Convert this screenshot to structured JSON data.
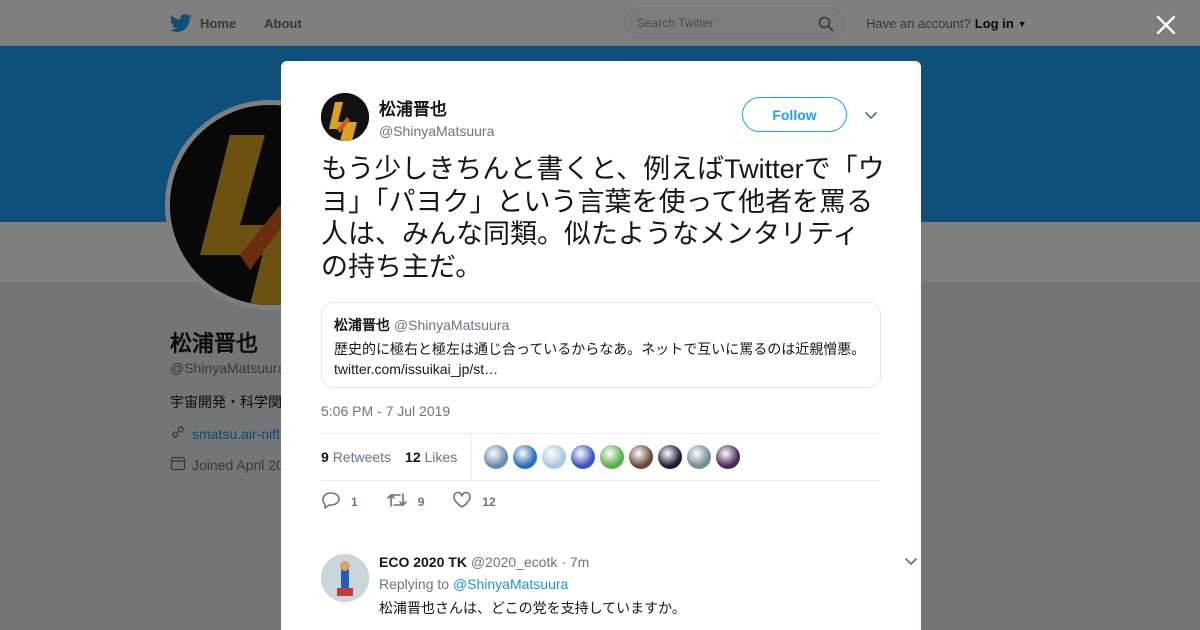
{
  "topbar": {
    "nav": [
      {
        "label": "Home",
        "icon": "bird-icon"
      },
      {
        "label": "About"
      }
    ],
    "search_placeholder": "Search Twitter",
    "account_prompt": "Have an account?",
    "login_label": "Log in"
  },
  "profile": {
    "name": "松浦晋也",
    "handle": "@ShinyaMatsuura",
    "bio": "宇宙開発・科学関",
    "website": "smatsu.air-nift",
    "joined": "Joined April 20"
  },
  "tweet": {
    "author_name": "松浦晋也",
    "author_handle": "@ShinyaMatsuura",
    "follow_label": "Follow",
    "text": "もう少しきちんと書くと、例えばTwitterで「ウヨ」「パヨク」という言葉を使って他者を罵る人は、みんな同類。似たようなメンタリティの持ち主だ。",
    "quote": {
      "name": "松浦晋也",
      "handle": "@ShinyaMatsuura",
      "text_line1": "歴史的に極右と極左は通じ合っているからなあ。ネットで互いに罵るのは近親憎悪。",
      "text_line2": "twitter.com/issuikai_jp/st…"
    },
    "timestamp": "5:06 PM - 7 Jul 2019",
    "retweets_count": "9",
    "retweets_label": "Retweets",
    "likes_count": "12",
    "likes_label": "Likes",
    "liker_colors": [
      "#6a8caf",
      "#2a6fb8",
      "#a9c8e0",
      "#3d54c2",
      "#58b04a",
      "#6b4a3a",
      "#1c1c3a",
      "#6f8f9a",
      "#4b2a5a"
    ],
    "actions": {
      "reply_count": "1",
      "retweet_count": "9",
      "like_count": "12"
    }
  },
  "reply": {
    "name": "ECO 2020 TK",
    "handle": "@2020_ecotk",
    "dot": "·",
    "age": "7m",
    "replying_prefix": "Replying to",
    "replying_to": "@ShinyaMatsuura",
    "text": "松浦晋也さんは、どこの党を支持していますか。"
  },
  "colors": {
    "accent": "#1da1f2",
    "link": "#1b95e0",
    "muted": "#657786"
  }
}
